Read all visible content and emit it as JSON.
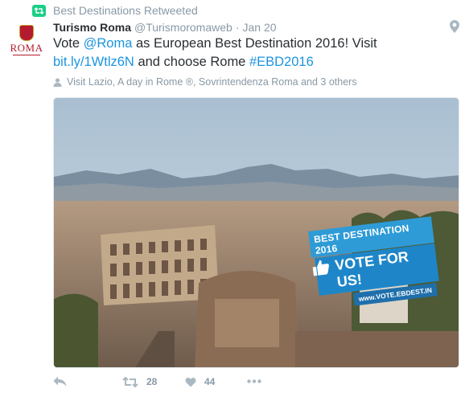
{
  "retweet_context": {
    "icon": "retweet-icon",
    "text": "Best Destinations Retweeted"
  },
  "tweet": {
    "display_name": "Turismo Roma",
    "handle": "@Turismoromaweb",
    "separator": "·",
    "date": "Jan 20",
    "avatar_text": "ROMA",
    "avatar_caption": "BENI TURISMO CULTURA",
    "location_icon": "map-pin-icon",
    "text_parts": {
      "p1": "Vote ",
      "mention": "@Roma",
      "p2": " as European Best Destination 2016! Visit ",
      "url": "bit.ly/1Wtlz6N",
      "p3": " and choose Rome ",
      "hashtag": "#EBD2016"
    },
    "tagged_users": "Visit Lazio, A day in Rome ®, Sovrintendenza Roma and 3 others"
  },
  "photo": {
    "badge_line1": "BEST DESTINATION 2016",
    "badge_line2": "VOTE FOR US!",
    "badge_line3": "www.VOTE.EBDEST.IN",
    "colors": {
      "badge_blue": "#1e86c8",
      "sky": "#c3d3e0"
    }
  },
  "actions": {
    "reply": {
      "icon": "reply-icon"
    },
    "retweet": {
      "icon": "retweet-icon",
      "count": "28"
    },
    "like": {
      "icon": "heart-icon",
      "count": "44"
    },
    "more": {
      "icon": "more-icon"
    }
  },
  "colors": {
    "link": "#1b95e0",
    "muted": "#8899a6",
    "retweet_green": "#19cf86",
    "text": "#292f33"
  }
}
